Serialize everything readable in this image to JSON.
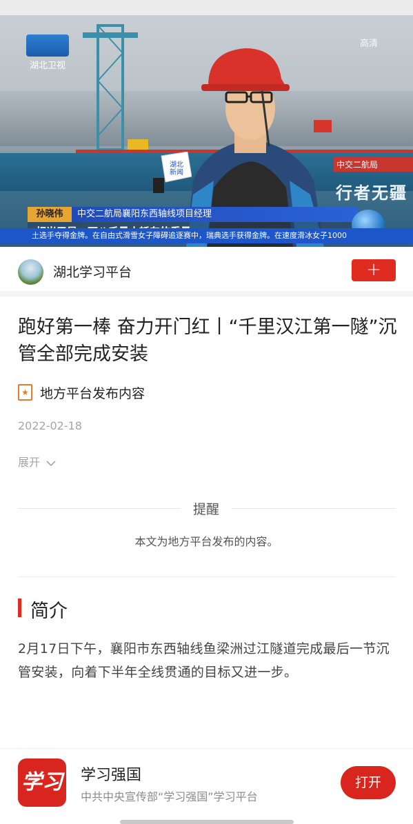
{
  "video": {
    "channel_logo": "湖北卫视",
    "corner_badge": "高清",
    "wall_text": "行者无疆",
    "sign_text": "中交二航局",
    "mic_label": "湖北新闻",
    "interviewee_name": "孙晓伟",
    "interviewee_title": "中交二航局襄阳东西轴线项目经理",
    "subtitle": "相当于是一万八千量小轿车的重量",
    "brand": "湖北新闻",
    "ticker": "土选手夺得金牌。在自由式滑雪女子障碍追逐赛中，瑞典选手获得金牌。在速度滑冰女子1000"
  },
  "source": {
    "name": "湖北学习平台",
    "follow_icon": "plus-icon",
    "follow_symbol": "+"
  },
  "article": {
    "title": "跑好第一棒 奋力开门红丨“千里汉江第一隧”沉管全部完成安装",
    "origin_label": "地方平台发布内容",
    "date": "2022-02-18",
    "expand_label": "展开",
    "expand_icon": "chevron-down-icon"
  },
  "notice": {
    "title": "提醒",
    "body": "本文为地方平台发布的内容。"
  },
  "summary_section": {
    "title": "简介",
    "text": "2月17日下午，襄阳市东西轴线鱼梁洲过江隧道完成最后一节沉管安装，向着下半年全线贯通的目标又进一步。"
  },
  "app_banner": {
    "icon_text": "学习",
    "name": "学习强国",
    "description": "中共中央宣传部“学习强国”学习平台",
    "open_label": "打开"
  },
  "colors": {
    "accent_red": "#e02b20",
    "origin_orange": "#e87a2b",
    "muted_text": "#a5a5a5"
  }
}
